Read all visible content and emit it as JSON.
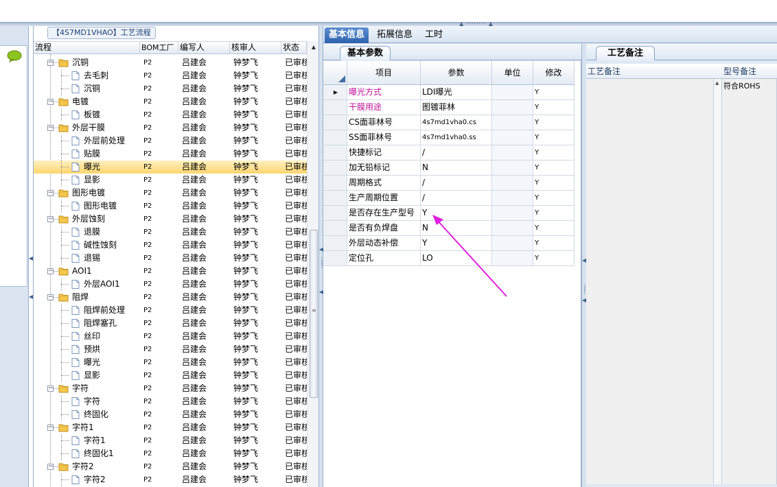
{
  "tree": {
    "title": "【4S7MD1VHAO】工艺流程",
    "columns": [
      "流程",
      "BOM工厂",
      "编写人",
      "核审人",
      "状态"
    ],
    "rows": [
      {
        "name": "沉铜",
        "level": 1,
        "bom": "P2",
        "author": "吕建会",
        "reviewer": "钟梦飞",
        "status": "已审核"
      },
      {
        "name": "去毛刺",
        "level": 2,
        "bom": "P2",
        "author": "吕建会",
        "reviewer": "钟梦飞",
        "status": "已审核"
      },
      {
        "name": "沉铜",
        "level": 2,
        "bom": "P2",
        "author": "吕建会",
        "reviewer": "钟梦飞",
        "status": "已审核"
      },
      {
        "name": "电镀",
        "level": 1,
        "bom": "P2",
        "author": "吕建会",
        "reviewer": "钟梦飞",
        "status": "已审核"
      },
      {
        "name": "板镀",
        "level": 2,
        "bom": "P2",
        "author": "吕建会",
        "reviewer": "钟梦飞",
        "status": "已审核"
      },
      {
        "name": "外层干膜",
        "level": 1,
        "bom": "P2",
        "author": "吕建会",
        "reviewer": "钟梦飞",
        "status": "已审核"
      },
      {
        "name": "外层前处理",
        "level": 2,
        "bom": "P2",
        "author": "吕建会",
        "reviewer": "钟梦飞",
        "status": "已审核"
      },
      {
        "name": "贴膜",
        "level": 2,
        "bom": "P2",
        "author": "吕建会",
        "reviewer": "钟梦飞",
        "status": "已审核"
      },
      {
        "name": "曝光",
        "level": 2,
        "bom": "P2",
        "author": "吕建会",
        "reviewer": "钟梦飞",
        "status": "已审核",
        "selected": true
      },
      {
        "name": "显影",
        "level": 2,
        "bom": "P2",
        "author": "吕建会",
        "reviewer": "钟梦飞",
        "status": "已审核"
      },
      {
        "name": "图形电镀",
        "level": 1,
        "bom": "P2",
        "author": "吕建会",
        "reviewer": "钟梦飞",
        "status": "已审核"
      },
      {
        "name": "图形电镀",
        "level": 2,
        "bom": "P2",
        "author": "吕建会",
        "reviewer": "钟梦飞",
        "status": "已审核"
      },
      {
        "name": "外层蚀刻",
        "level": 1,
        "bom": "P2",
        "author": "吕建会",
        "reviewer": "钟梦飞",
        "status": "已审核"
      },
      {
        "name": "退膜",
        "level": 2,
        "bom": "P2",
        "author": "吕建会",
        "reviewer": "钟梦飞",
        "status": "已审核"
      },
      {
        "name": "碱性蚀刻",
        "level": 2,
        "bom": "P2",
        "author": "吕建会",
        "reviewer": "钟梦飞",
        "status": "已审核"
      },
      {
        "name": "退锡",
        "level": 2,
        "bom": "P2",
        "author": "吕建会",
        "reviewer": "钟梦飞",
        "status": "已审核"
      },
      {
        "name": "AOI1",
        "level": 1,
        "bom": "P2",
        "author": "吕建会",
        "reviewer": "钟梦飞",
        "status": "已审核"
      },
      {
        "name": "外层AOI1",
        "level": 2,
        "bom": "P2",
        "author": "吕建会",
        "reviewer": "钟梦飞",
        "status": "已审核"
      },
      {
        "name": "阻焊",
        "level": 1,
        "bom": "P2",
        "author": "吕建会",
        "reviewer": "钟梦飞",
        "status": "已审核"
      },
      {
        "name": "阻焊前处理",
        "level": 2,
        "bom": "P2",
        "author": "吕建会",
        "reviewer": "钟梦飞",
        "status": "已审核"
      },
      {
        "name": "阻焊塞孔",
        "level": 2,
        "bom": "P2",
        "author": "吕建会",
        "reviewer": "钟梦飞",
        "status": "已审核"
      },
      {
        "name": "丝印",
        "level": 2,
        "bom": "P2",
        "author": "吕建会",
        "reviewer": "钟梦飞",
        "status": "已审核"
      },
      {
        "name": "预烘",
        "level": 2,
        "bom": "P2",
        "author": "吕建会",
        "reviewer": "钟梦飞",
        "status": "已审核"
      },
      {
        "name": "曝光",
        "level": 2,
        "bom": "P2",
        "author": "吕建会",
        "reviewer": "钟梦飞",
        "status": "已审核"
      },
      {
        "name": "显影",
        "level": 2,
        "bom": "P2",
        "author": "吕建会",
        "reviewer": "钟梦飞",
        "status": "已审核"
      },
      {
        "name": "字符",
        "level": 1,
        "bom": "P2",
        "author": "吕建会",
        "reviewer": "钟梦飞",
        "status": "已审核"
      },
      {
        "name": "字符",
        "level": 2,
        "bom": "P2",
        "author": "吕建会",
        "reviewer": "钟梦飞",
        "status": "已审核"
      },
      {
        "name": "终固化",
        "level": 2,
        "bom": "P2",
        "author": "吕建会",
        "reviewer": "钟梦飞",
        "status": "已审核"
      },
      {
        "name": "字符1",
        "level": 1,
        "bom": "P2",
        "author": "吕建会",
        "reviewer": "钟梦飞",
        "status": "已审核"
      },
      {
        "name": "字符1",
        "level": 2,
        "bom": "P2",
        "author": "吕建会",
        "reviewer": "钟梦飞",
        "status": "已审核"
      },
      {
        "name": "终固化1",
        "level": 2,
        "bom": "P2",
        "author": "吕建会",
        "reviewer": "钟梦飞",
        "status": "已审核"
      },
      {
        "name": "字符2",
        "level": 1,
        "bom": "P2",
        "author": "吕建会",
        "reviewer": "钟梦飞",
        "status": "已审核"
      },
      {
        "name": "字符2",
        "level": 2,
        "bom": "P2",
        "author": "吕建会",
        "reviewer": "钟梦飞",
        "status": "已审核"
      }
    ]
  },
  "tabs": [
    {
      "label": "基本信息",
      "active": true
    },
    {
      "label": "拓展信息",
      "active": false
    },
    {
      "label": "工时",
      "active": false
    }
  ],
  "params": {
    "subtab": "基本参数",
    "columns": [
      "项目",
      "参数",
      "单位",
      "修改"
    ],
    "rows": [
      {
        "item": "曝光方式",
        "value": "LDI曝光",
        "unit": "",
        "modify": "Y",
        "highlight": true,
        "current": true
      },
      {
        "item": "干膜用途",
        "value": "图镀菲林",
        "unit": "",
        "modify": "Y",
        "highlight": true
      },
      {
        "item": "CS面菲林号",
        "value": "4s7md1vha0.cs",
        "unit": "",
        "modify": "Y"
      },
      {
        "item": "SS面菲林号",
        "value": "4s7md1vha0.ss",
        "unit": "",
        "modify": "Y"
      },
      {
        "item": "快捷标记",
        "value": "/",
        "unit": "",
        "modify": "Y"
      },
      {
        "item": "加无铅标记",
        "value": "N",
        "unit": "",
        "modify": "Y"
      },
      {
        "item": "周期格式",
        "value": "/",
        "unit": "",
        "modify": "Y"
      },
      {
        "item": "生产周期位置",
        "value": "/",
        "unit": "",
        "modify": "Y"
      },
      {
        "item": "是否存在生产型号",
        "value": "Y",
        "unit": "",
        "modify": "Y"
      },
      {
        "item": "是否有负焊盘",
        "value": "N",
        "unit": "",
        "modify": "Y"
      },
      {
        "item": "外层动态补偿",
        "value": "Y",
        "unit": "",
        "modify": "Y"
      },
      {
        "item": "定位孔",
        "value": "LO",
        "unit": "",
        "modify": "Y"
      }
    ]
  },
  "remarks": {
    "tab": "工艺备注",
    "columns": [
      "工艺备注",
      "型号备注"
    ],
    "model_remark_value": "符合ROHS"
  },
  "colors": {
    "highlight_text": "#c0149a",
    "selected_row": "#fdd56e",
    "annotation_arrow": "#e020e0",
    "active_tab": "#2d62ad"
  }
}
